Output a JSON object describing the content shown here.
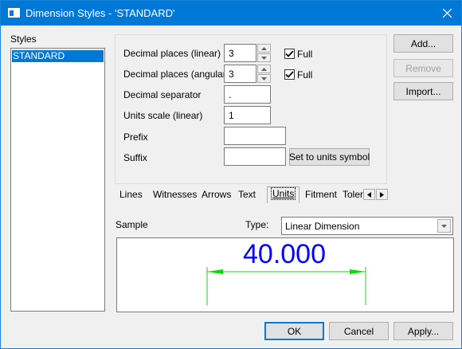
{
  "window": {
    "title": "Dimension Styles - 'STANDARD'"
  },
  "styles": {
    "label": "Styles",
    "items": [
      "STANDARD"
    ],
    "selected": "STANDARD"
  },
  "settings": {
    "decimal_linear": {
      "label": "Decimal places (linear)",
      "value": "3",
      "full_label": "Full",
      "full_checked": true
    },
    "decimal_angular": {
      "label": "Decimal places (angular)",
      "value": "3",
      "full_label": "Full",
      "full_checked": true
    },
    "decimal_separator": {
      "label": "Decimal separator",
      "value": "."
    },
    "units_scale": {
      "label": "Units scale (linear)",
      "value": "1"
    },
    "prefix": {
      "label": "Prefix",
      "value": ""
    },
    "suffix": {
      "label": "Suffix",
      "value": "",
      "button_label": "Set to units symbol"
    }
  },
  "side_buttons": {
    "add": "Add...",
    "remove": "Remove",
    "import": "Import..."
  },
  "tabs": [
    {
      "label": "Lines",
      "active": false
    },
    {
      "label": "Witnesses",
      "active": false
    },
    {
      "label": "Arrows",
      "active": false
    },
    {
      "label": "Text",
      "active": false
    },
    {
      "label": "Units",
      "active": true
    },
    {
      "label": "Fitment",
      "active": false
    },
    {
      "label": "Toler",
      "active": false
    }
  ],
  "sample": {
    "label": "Sample",
    "type_label": "Type:",
    "type_value": "Linear Dimension",
    "preview_text": "40.000"
  },
  "footer": {
    "ok": "OK",
    "cancel": "Cancel",
    "apply": "Apply..."
  },
  "colors": {
    "titlebar": "#0078d7",
    "selection": "#0078d7",
    "dimension_text": "#0000ff",
    "dimension_lines": "#00dd00"
  }
}
